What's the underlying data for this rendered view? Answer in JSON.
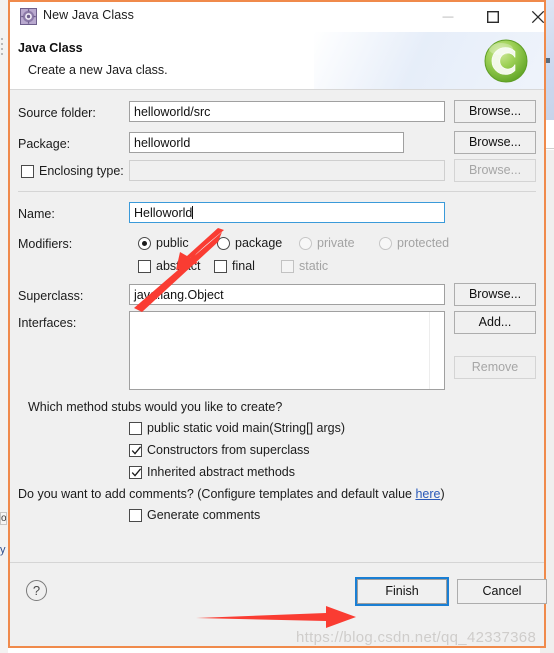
{
  "window": {
    "title": "New Java Class",
    "icon": "java-class-icon",
    "controls": {
      "minimize": "minimize-icon",
      "maximize": "maximize-icon",
      "close": "close-icon"
    }
  },
  "banner": {
    "title": "Java Class",
    "subtitle": "Create a new Java class.",
    "logo": "eclipse-green-c-logo"
  },
  "form": {
    "source_folder": {
      "label": "Source folder:",
      "value": "helloworld/src",
      "button": "Browse..."
    },
    "package": {
      "label": "Package:",
      "value": "helloworld",
      "button": "Browse..."
    },
    "enclosing_type": {
      "label": "Enclosing type:",
      "checked": false,
      "value": "",
      "button": "Browse...",
      "disabled": true
    },
    "name": {
      "label": "Name:",
      "value": "Helloworld",
      "focused": true
    },
    "modifiers": {
      "label": "Modifiers:",
      "radios": [
        {
          "label": "public",
          "selected": true,
          "disabled": false
        },
        {
          "label": "package",
          "selected": false,
          "disabled": false
        },
        {
          "label": "private",
          "selected": false,
          "disabled": true
        },
        {
          "label": "protected",
          "selected": false,
          "disabled": true
        }
      ],
      "checkboxes": [
        {
          "label": "abstract",
          "checked": false,
          "disabled": false
        },
        {
          "label": "final",
          "checked": false,
          "disabled": false
        },
        {
          "label": "static",
          "checked": false,
          "disabled": true
        }
      ]
    },
    "superclass": {
      "label": "Superclass:",
      "value": "java.lang.Object",
      "button": "Browse..."
    },
    "interfaces": {
      "label": "Interfaces:",
      "items": [],
      "add_button": "Add...",
      "remove_button": "Remove",
      "remove_disabled": true
    },
    "method_stubs": {
      "question": "Which method stubs would you like to create?",
      "options": [
        {
          "label": "public static void main(String[] args)",
          "checked": false
        },
        {
          "label": "Constructors from superclass",
          "checked": true
        },
        {
          "label": "Inherited abstract methods",
          "checked": true
        }
      ]
    },
    "comments": {
      "question_prefix": "Do you want to add comments? (Configure templates and default value ",
      "link": "here",
      "question_suffix": ")",
      "option": {
        "label": "Generate comments",
        "checked": false
      }
    }
  },
  "footer": {
    "help": "?",
    "finish": "Finish",
    "cancel": "Cancel"
  },
  "annotations": {
    "arrow_to_name": "red-arrow-pointing-to-name-field",
    "arrow_to_finish": "red-arrow-pointing-to-finish-button",
    "watermark": "https://blog.csdn.net/qq_42337368"
  },
  "colors": {
    "dialog_border": "#f08a4b",
    "accent_focus": "#1a7fd4",
    "annotation_red": "#fa3c32",
    "link": "#2a59b8",
    "logo_green": "#7dc242"
  }
}
